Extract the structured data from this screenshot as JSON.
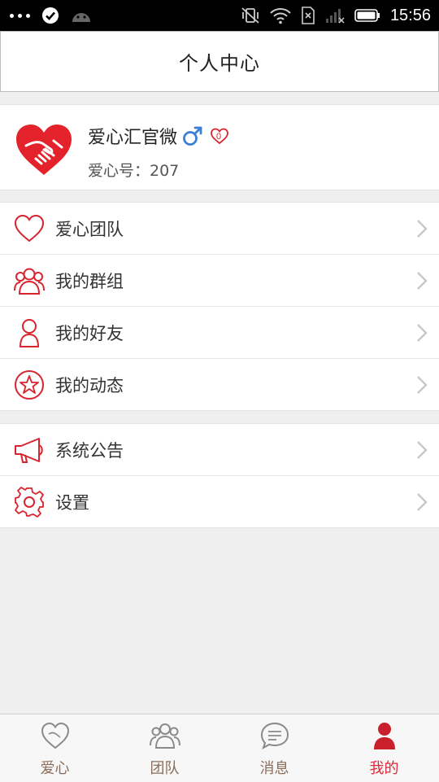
{
  "status_bar": {
    "time": "15:56"
  },
  "header": {
    "title": "个人中心"
  },
  "profile": {
    "name": "爱心汇官微",
    "love_count": "0",
    "id_text": "爱心号：207"
  },
  "menu_group_1": {
    "items": [
      {
        "label": "爱心团队",
        "icon": "heart-icon"
      },
      {
        "label": "我的群组",
        "icon": "group-icon"
      },
      {
        "label": "我的好友",
        "icon": "person-icon"
      },
      {
        "label": "我的动态",
        "icon": "star-icon"
      }
    ]
  },
  "menu_group_2": {
    "items": [
      {
        "label": "系统公告",
        "icon": "megaphone-icon"
      },
      {
        "label": "设置",
        "icon": "gear-icon"
      }
    ]
  },
  "tab_bar": {
    "tabs": [
      {
        "label": "爱心",
        "icon": "heart-icon"
      },
      {
        "label": "团队",
        "icon": "group-icon"
      },
      {
        "label": "消息",
        "icon": "chat-icon"
      },
      {
        "label": "我的",
        "icon": "person-icon",
        "active": true
      }
    ]
  },
  "colors": {
    "accent": "#e0283a",
    "icon_red": "#d9232e",
    "gender_blue": "#3a7fd5"
  }
}
